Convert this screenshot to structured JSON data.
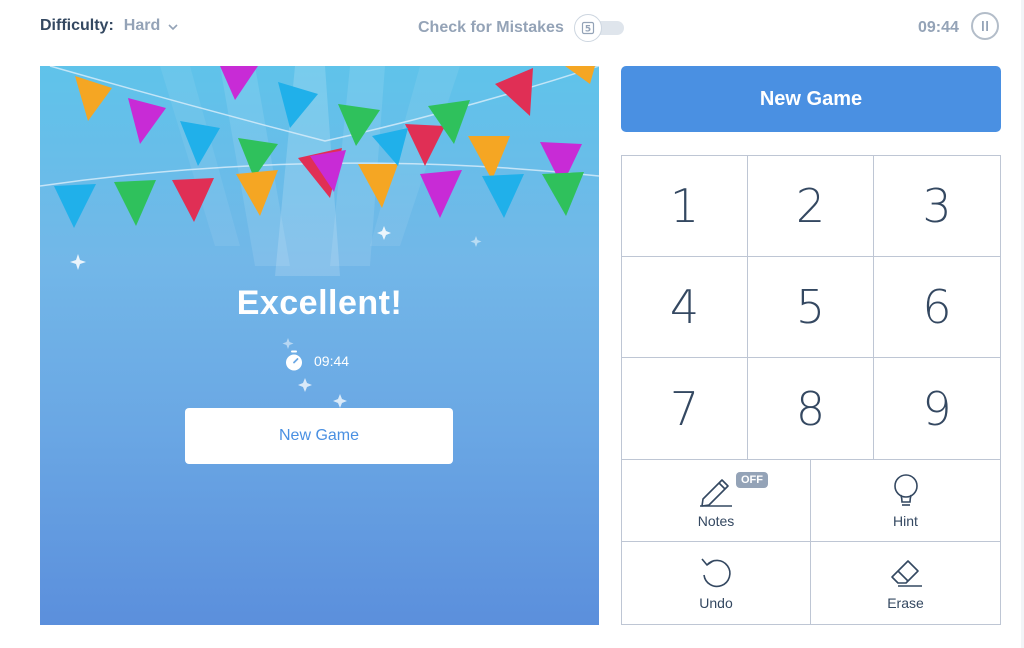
{
  "header": {
    "difficulty_label": "Difficulty:",
    "difficulty_value": "Hard",
    "check_mistakes_label": "Check for Mistakes",
    "check_mistakes_enabled": false,
    "timer": "09:44"
  },
  "board_overlay": {
    "title": "Excellent!",
    "time": "09:44",
    "new_game_label": "New Game"
  },
  "side": {
    "new_game_label": "New Game",
    "numbers": [
      "1",
      "2",
      "3",
      "4",
      "5",
      "6",
      "7",
      "8",
      "9"
    ],
    "tools": {
      "notes_label": "Notes",
      "notes_badge": "OFF",
      "hint_label": "Hint",
      "undo_label": "Undo",
      "erase_label": "Erase"
    }
  },
  "icons": [
    "chevron-down-icon",
    "mistake-check-icon",
    "pause-icon",
    "stopwatch-icon",
    "pencil-icon",
    "lightbulb-icon",
    "undo-icon",
    "eraser-icon"
  ],
  "colors": {
    "accent": "#4a90e2",
    "text_primary": "#344861",
    "text_muted": "#94a3b7",
    "grid_border": "#bec6d4"
  }
}
